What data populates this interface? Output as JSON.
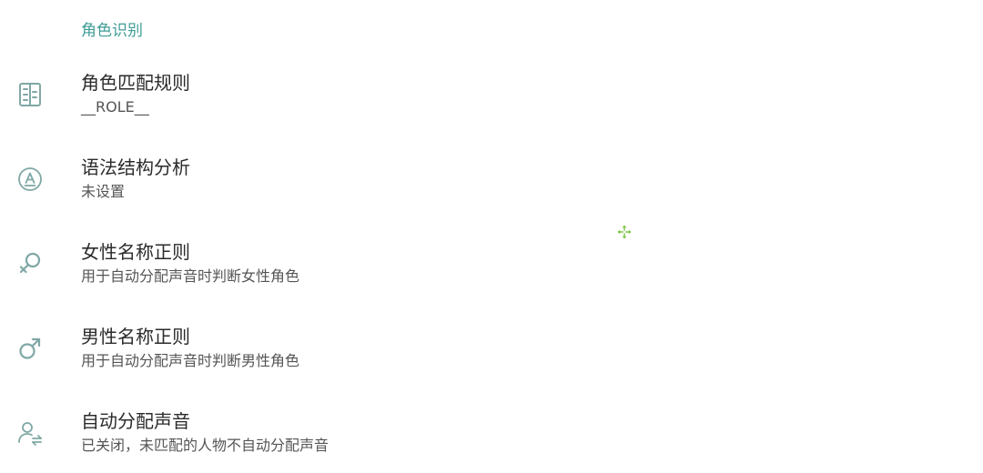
{
  "section": {
    "title": "角色识别"
  },
  "colors": {
    "accent": "#3f9c96",
    "icon": "#7fa8a5",
    "cursor": "#7cc242"
  },
  "items": [
    {
      "icon": "rule-list-icon",
      "title": "角色匹配规则",
      "summary": "__ROLE__"
    },
    {
      "icon": "grammar-a-icon",
      "title": "语法结构分析",
      "summary": "未设置"
    },
    {
      "icon": "female-symbol-icon",
      "title": "女性名称正则",
      "summary": "用于自动分配声音时判断女性角色"
    },
    {
      "icon": "male-symbol-icon",
      "title": "男性名称正则",
      "summary": "用于自动分配声音时判断男性角色"
    },
    {
      "icon": "person-voice-icon",
      "title": "自动分配声音",
      "summary": "已关闭，未匹配的人物不自动分配声音"
    }
  ]
}
